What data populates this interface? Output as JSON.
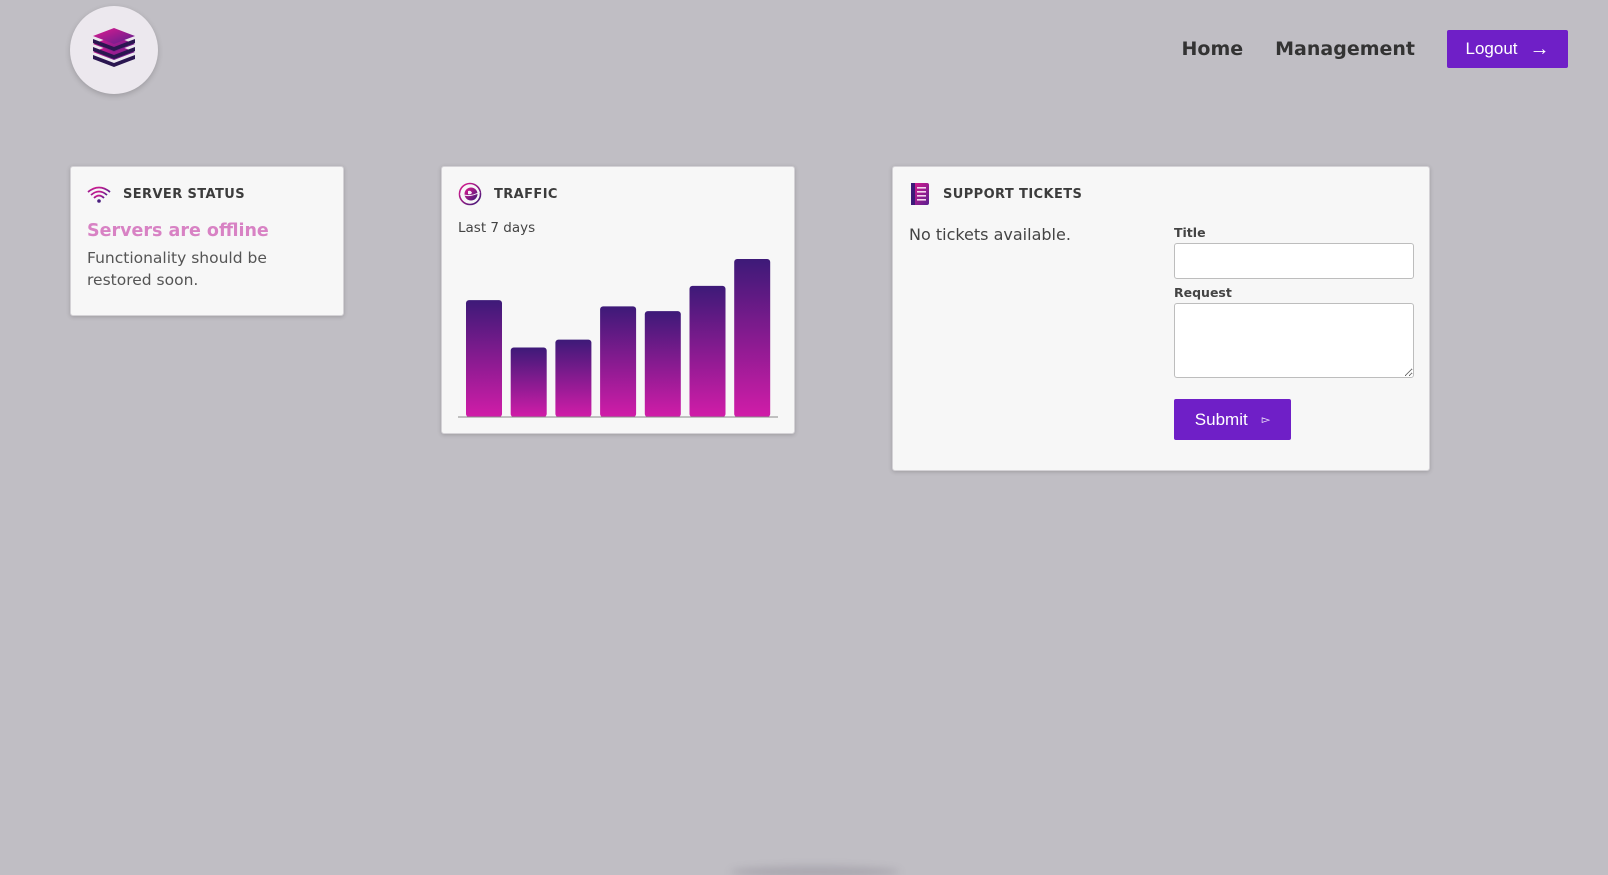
{
  "header": {
    "logo_icon": "layer-stack-icon",
    "nav": [
      {
        "label": "Home"
      },
      {
        "label": "Management"
      }
    ],
    "logout_label": "Logout",
    "logout_icon": "arrow-right-icon"
  },
  "server_status": {
    "title": "SERVER STATUS",
    "icon": "wifi-icon",
    "headline": "Servers are offline",
    "message": "Functionality should be restored soon."
  },
  "traffic": {
    "title": "TRAFFIC",
    "icon": "globe-icon",
    "subtitle": "Last 7 days"
  },
  "support": {
    "title": "SUPPORT TICKETS",
    "icon": "notebook-icon",
    "empty_text": "No tickets available.",
    "form": {
      "title_label": "Title",
      "title_value": "",
      "request_label": "Request",
      "request_value": "",
      "submit_label": "Submit",
      "submit_icon": "send-icon"
    }
  },
  "colors": {
    "accent": "#6f1fc7",
    "status_offline": "#d882c4",
    "bar_top": "#3d1a78",
    "bar_bottom": "#d11ca8",
    "background": "#c0bec4"
  },
  "chart_data": {
    "type": "bar",
    "categories": [
      "",
      "",
      "",
      "",
      "",
      "",
      ""
    ],
    "values": [
      74,
      44,
      49,
      70,
      67,
      83,
      100
    ],
    "ylim": [
      0,
      100
    ],
    "grid": false
  }
}
